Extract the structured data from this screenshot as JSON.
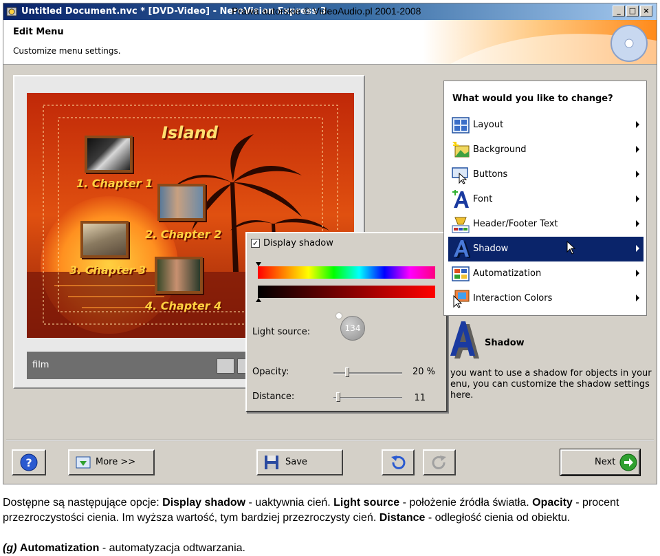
{
  "window": {
    "title": "Untitled Document.nvc * [DVD-Video] - NeroVision Express 3",
    "watermark": "Prawa autorskie © VideoAudio.pl 2001-2008",
    "controls": [
      "_",
      "□",
      "×"
    ]
  },
  "header": {
    "title": "Edit Menu",
    "subtitle": "Customize menu settings."
  },
  "preview": {
    "menu_title": "Island",
    "chapters": [
      "1. Chapter 1",
      "2. Chapter 2",
      "3. Chapter 3",
      "4. Chapter 4"
    ],
    "footer_text": "film"
  },
  "shadow_panel": {
    "checkbox_label": "Display shadow",
    "checked": true,
    "light_source_label": "Light source:",
    "light_source_value": "134",
    "opacity_label": "Opacity:",
    "opacity_value": "20 %",
    "opacity_fraction": 0.2,
    "distance_label": "Distance:",
    "distance_value": "11"
  },
  "change_panel": {
    "question": "What would you like to change?",
    "options": [
      {
        "label": "Layout",
        "icon": "layout-icon"
      },
      {
        "label": "Background",
        "icon": "background-icon"
      },
      {
        "label": "Buttons",
        "icon": "buttons-icon"
      },
      {
        "label": "Font",
        "icon": "font-icon"
      },
      {
        "label": "Header/Footer Text",
        "icon": "header-footer-icon"
      },
      {
        "label": "Shadow",
        "icon": "shadow-icon",
        "selected": true
      },
      {
        "label": "Automatization",
        "icon": "automatization-icon"
      },
      {
        "label": "Interaction Colors",
        "icon": "interaction-colors-icon"
      }
    ]
  },
  "description": {
    "title": "Shadow",
    "text": "you want to use a shadow for objects in your\nenu, you can customize the shadow settings here."
  },
  "buttons": {
    "help": "?",
    "more": "More >>",
    "save": "Save",
    "next": "Next"
  },
  "caption": {
    "p1": "Dostępne są następujące opcje: ",
    "b1": "Display shadow",
    "p2": " - uaktywnia cień. ",
    "b2": "Light source",
    "p3": " - położenie źródła światła. ",
    "b3": "Opacity",
    "p4": " - procent przezroczystości cienia. Im wyższa wartość, tym bardziej przezroczysty cień.  ",
    "b4": "Distance",
    "p5": " - odległość cienia od obiektu.",
    "g_label": "(g)",
    "b5": "Automatization",
    "p6": " - automatyzacja odtwarzania."
  },
  "colors": {
    "selection": "#0a246a",
    "window_bg": "#d4d0c8"
  }
}
